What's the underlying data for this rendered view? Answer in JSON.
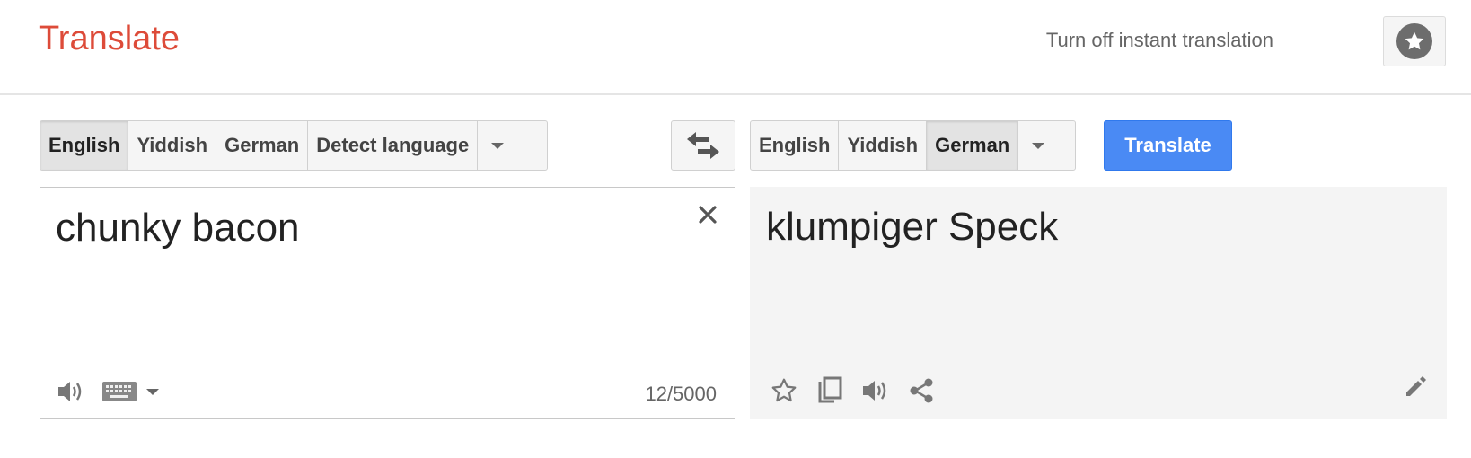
{
  "header": {
    "brand": "Translate",
    "instant_link": "Turn off instant translation"
  },
  "source": {
    "langs": [
      "English",
      "Yiddish",
      "German",
      "Detect language"
    ],
    "selected": "English",
    "text": "chunky bacon",
    "counter": "12/5000"
  },
  "target": {
    "langs": [
      "English",
      "Yiddish",
      "German"
    ],
    "selected": "German",
    "text": "klumpiger Speck"
  },
  "actions": {
    "translate_label": "Translate"
  },
  "colors": {
    "brand": "#dd4b39",
    "translate_button": "#4a8af4",
    "output_bg": "#f4f4f4"
  },
  "icons": {
    "star_button": "star-icon",
    "swap": "swap-arrows-icon",
    "clear": "close-icon",
    "source_tools": [
      "speaker-icon",
      "keyboard-icon",
      "chevron-down-icon"
    ],
    "target_tools": [
      "star-outline-icon",
      "copy-icon",
      "speaker-icon",
      "share-icon"
    ],
    "edit": "pencil-icon"
  }
}
